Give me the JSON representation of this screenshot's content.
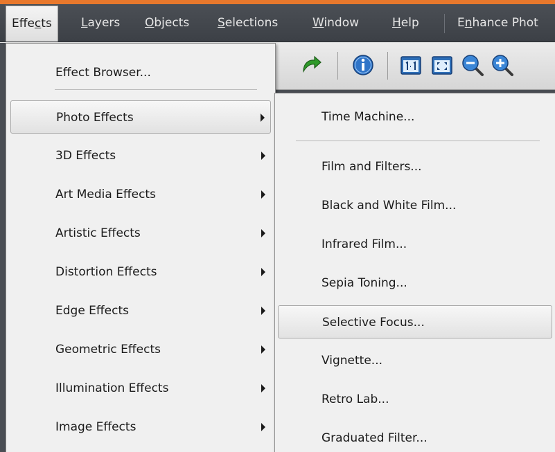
{
  "menubar": {
    "items": [
      {
        "pre": "Effe",
        "key": "c",
        "post": "ts",
        "active": true
      },
      {
        "pre": "",
        "key": "L",
        "post": "ayers"
      },
      {
        "pre": "",
        "key": "O",
        "post": "bjects"
      },
      {
        "pre": "",
        "key": "S",
        "post": "elections"
      },
      {
        "pre": "",
        "key": "W",
        "post": "indow"
      },
      {
        "pre": "",
        "key": "H",
        "post": "elp"
      },
      {
        "pre": "E",
        "key": "n",
        "post": "hance Phot"
      }
    ]
  },
  "effects_menu": {
    "items": [
      {
        "label": "Effect Browser..."
      },
      {
        "label": "Photo Effects",
        "submenu": true,
        "highlighted": true
      },
      {
        "label": "3D Effects",
        "submenu": true
      },
      {
        "label": "Art Media Effects",
        "submenu": true
      },
      {
        "label": "Artistic Effects",
        "submenu": true
      },
      {
        "label": "Distortion Effects",
        "submenu": true
      },
      {
        "label": "Edge Effects",
        "submenu": true
      },
      {
        "label": "Geometric Effects",
        "submenu": true
      },
      {
        "label": "Illumination Effects",
        "submenu": true
      },
      {
        "label": "Image Effects",
        "submenu": true
      }
    ]
  },
  "photo_effects_submenu": {
    "items": [
      {
        "label": "Time Machine..."
      },
      {
        "label": "Film and Filters..."
      },
      {
        "label": "Black and White Film..."
      },
      {
        "label": "Infrared Film..."
      },
      {
        "label": "Sepia Toning..."
      },
      {
        "label": "Selective Focus...",
        "highlighted": true
      },
      {
        "label": "Vignette..."
      },
      {
        "label": "Retro Lab..."
      },
      {
        "label": "Graduated Filter..."
      }
    ]
  },
  "colors": {
    "accent": "#e8782c",
    "menubar": "#43474d",
    "menu_background": "#f0f0f0",
    "highlight_border": "#a9a9a9"
  },
  "toolbar_icons": [
    "redo-icon",
    "info-icon",
    "actual-size-icon",
    "fit-window-icon",
    "zoom-out-icon",
    "zoom-in-icon"
  ]
}
